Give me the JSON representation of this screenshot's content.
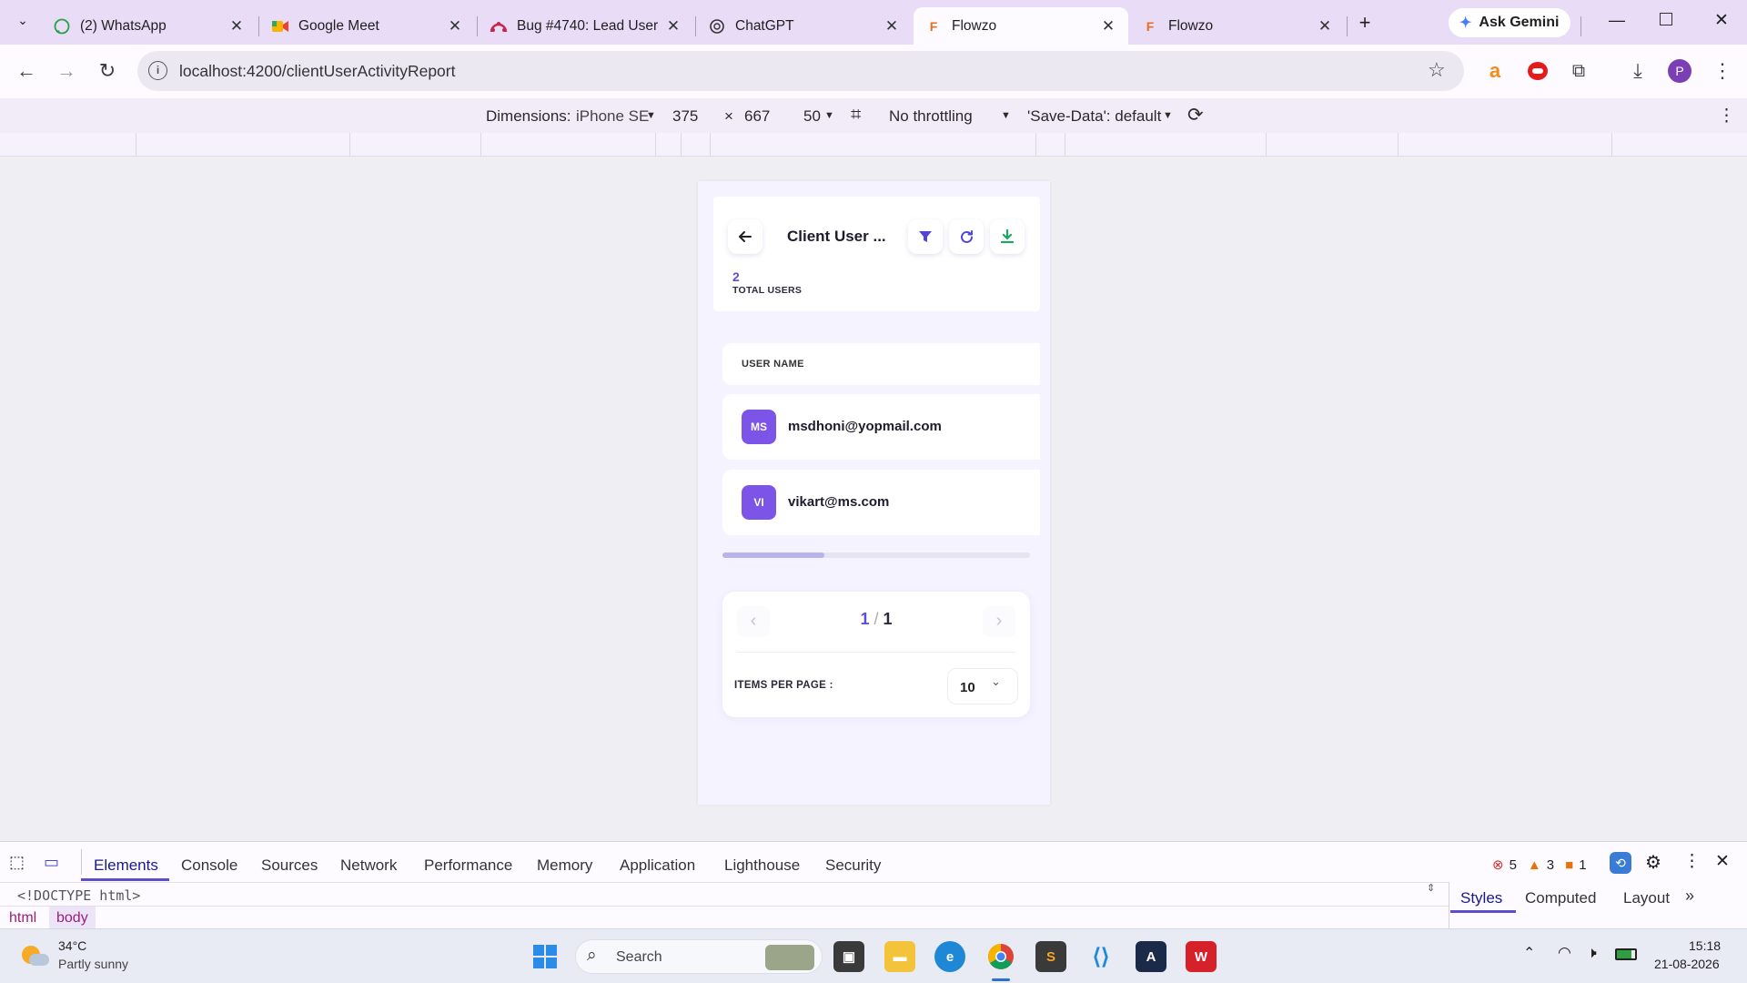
{
  "browser": {
    "tabs": [
      {
        "title": "(2) WhatsApp",
        "icon": "whatsapp-icon"
      },
      {
        "title": "Google Meet",
        "icon": "google-meet-icon"
      },
      {
        "title": "Bug #4740: Lead User",
        "icon": "bug-tracker-icon"
      },
      {
        "title": "ChatGPT",
        "icon": "chatgpt-icon"
      },
      {
        "title": "Flowzo",
        "icon": "flowzo-icon"
      },
      {
        "title": "Flowzo",
        "icon": "flowzo-icon"
      }
    ],
    "new_tab": "+",
    "ask_gemini": "Ask Gemini",
    "url": "localhost:4200/clientUserActivityReport",
    "profile_initial": "P"
  },
  "device_toolbar": {
    "dimensions_label": "Dimensions:",
    "device": "iPhone SE",
    "width": "375",
    "times": "×",
    "height": "667",
    "zoom": "50",
    "throttling": "No throttling",
    "save_data": "'Save-Data': default"
  },
  "app": {
    "title": "Client User ...",
    "total_count": "2",
    "total_label": "TOTAL USERS",
    "column_header": "USER NAME",
    "users": [
      {
        "initials": "MS",
        "email": "msdhoni@yopmail.com"
      },
      {
        "initials": "VI",
        "email": "vikart@ms.com"
      }
    ],
    "pagination": {
      "current": "1",
      "separator": "/",
      "total": "1"
    },
    "items_per_page_label": "ITEMS PER PAGE :",
    "items_per_page_value": "10",
    "scroll_progress": 0.33
  },
  "devtools": {
    "tabs": [
      "Elements",
      "Console",
      "Sources",
      "Network",
      "Performance",
      "Memory",
      "Application",
      "Lighthouse",
      "Security"
    ],
    "errors": "5",
    "warnings": "3",
    "infos": "1",
    "doctype": "<!DOCTYPE html>",
    "breadcrumb": [
      "html",
      "body"
    ],
    "side_tabs": [
      "Styles",
      "Computed",
      "Layout"
    ]
  },
  "taskbar": {
    "weather_temp": "34°C",
    "weather_desc": "Partly sunny",
    "search_placeholder": "Search",
    "time": "15:18",
    "date": "21-08-2026"
  },
  "colors": {
    "accent": "#5a4fd6",
    "avatar": "#7c55e8",
    "download_green": "#1fa463"
  }
}
